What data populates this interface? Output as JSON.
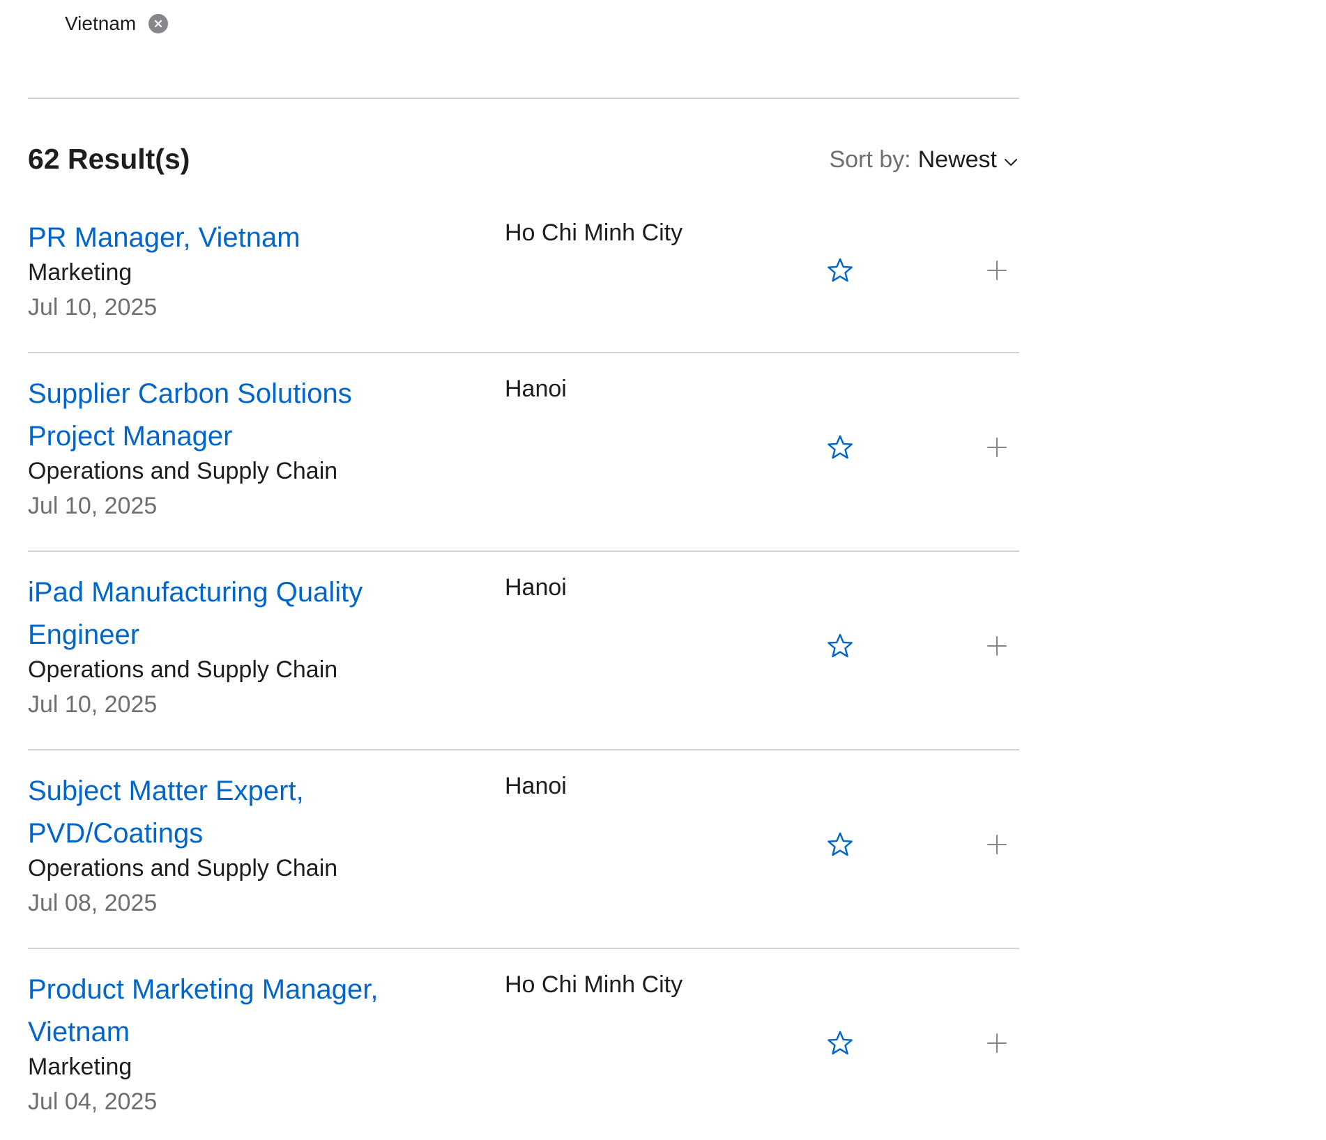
{
  "filter": {
    "chip_label": "Vietnam"
  },
  "results": {
    "count_label": "62 Result(s)",
    "sort_label": "Sort by:",
    "sort_value": "Newest"
  },
  "colors": {
    "link": "#0066cc",
    "text": "#1d1d1f",
    "secondary": "#6e6e73",
    "divider": "#d2d2d7",
    "chip_close_bg": "#86868b",
    "icon_gray": "#86868b"
  },
  "icons": {
    "chip_remove": "close-circle-icon",
    "sort": "chevron-down-icon",
    "favorite": "star-outline-icon",
    "add": "plus-icon"
  },
  "jobs": [
    {
      "title": "PR Manager, Vietnam",
      "team": "Marketing",
      "date": "Jul 10, 2025",
      "location": "Ho Chi Minh City"
    },
    {
      "title": "Supplier Carbon Solutions Project Manager",
      "team": "Operations and Supply Chain",
      "date": "Jul 10, 2025",
      "location": "Hanoi"
    },
    {
      "title": "iPad Manufacturing Quality Engineer",
      "team": "Operations and Supply Chain",
      "date": "Jul 10, 2025",
      "location": "Hanoi"
    },
    {
      "title": "Subject Matter Expert, PVD/Coatings",
      "team": "Operations and Supply Chain",
      "date": "Jul 08, 2025",
      "location": "Hanoi"
    },
    {
      "title": "Product Marketing Manager, Vietnam",
      "team": "Marketing",
      "date": "Jul 04, 2025",
      "location": "Ho Chi Minh City"
    }
  ]
}
